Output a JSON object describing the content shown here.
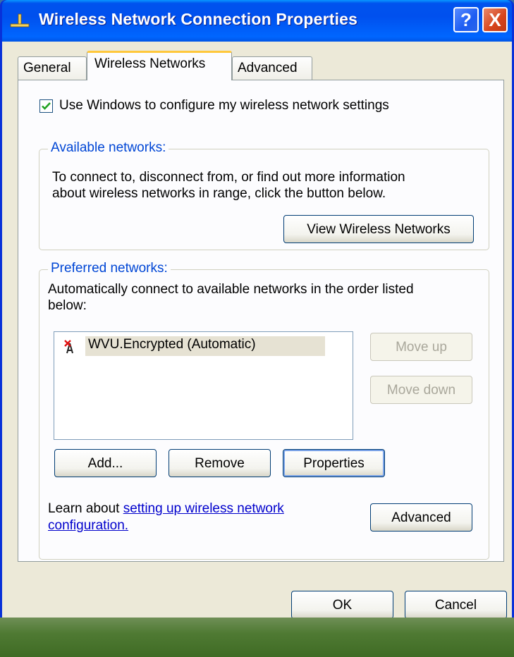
{
  "window": {
    "title": "Wireless Network Connection Properties"
  },
  "title_buttons": {
    "help": "?",
    "close": "X"
  },
  "tabs": [
    {
      "label": "General"
    },
    {
      "label": "Wireless Networks"
    },
    {
      "label": "Advanced"
    }
  ],
  "use_windows": {
    "checked": true,
    "label": "Use Windows to configure my wireless network settings"
  },
  "available": {
    "legend": "Available networks:",
    "text_line1": "To connect to, disconnect from, or find out more information",
    "text_line2": "about wireless networks in range, click the button below.",
    "view_button": "View Wireless Networks"
  },
  "preferred": {
    "legend": "Preferred networks:",
    "text_line1": "Automatically connect to available networks in the order listed",
    "text_line2": "below:",
    "networks": [
      {
        "name": "WVU.Encrypted (Automatic)",
        "icon": "wireless-disconnected-icon"
      }
    ],
    "move_up": "Move up",
    "move_down": "Move down",
    "add": "Add...",
    "remove": "Remove",
    "properties": "Properties",
    "learn_prefix": "Learn about ",
    "learn_link_line1": "setting up wireless network",
    "learn_link_line2": "configuration.",
    "advanced": "Advanced"
  },
  "footer": {
    "ok": "OK",
    "cancel": "Cancel"
  },
  "colors": {
    "title_bar": "#0053ee",
    "legend": "#0046d5",
    "link": "#0000cc",
    "dialog_bg": "#ece9d8"
  }
}
